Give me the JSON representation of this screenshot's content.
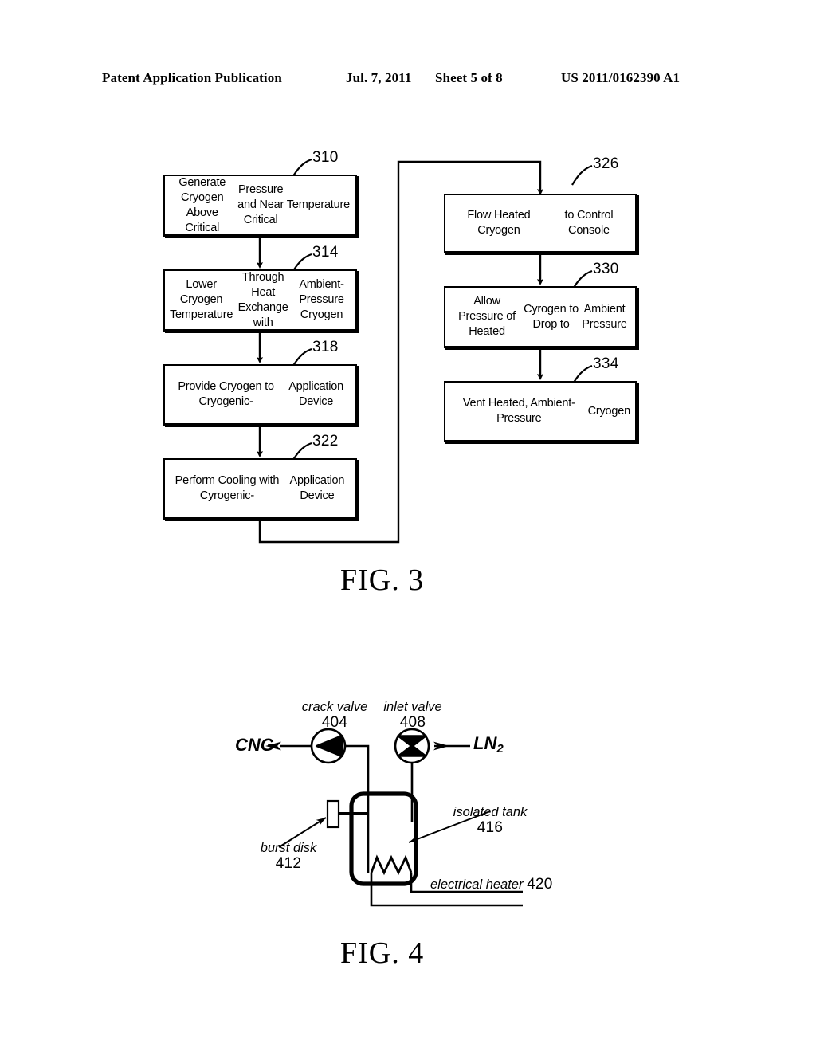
{
  "header": {
    "publication": "Patent Application Publication",
    "date": "Jul. 7, 2011",
    "sheet": "Sheet 5 of 8",
    "number": "US 2011/0162390 A1"
  },
  "figures": [
    {
      "caption": "FIG. 3",
      "type": "flowchart",
      "boxes": [
        {
          "ref": "310",
          "lines": [
            "Generate Cryogen Above Critical",
            "Pressure and Near Critical",
            "Temperature"
          ]
        },
        {
          "ref": "314",
          "lines": [
            "Lower Cryogen Temperature",
            "Through Heat Exchange with",
            "Ambient-Pressure Cryogen"
          ]
        },
        {
          "ref": "318",
          "lines": [
            "Provide Cryogen to Cryogenic-",
            "Application Device"
          ]
        },
        {
          "ref": "322",
          "lines": [
            "Perform Cooling with Cyrogenic-",
            "Application Device"
          ]
        },
        {
          "ref": "326",
          "lines": [
            "Flow Heated Cryogen",
            "to Control Console"
          ]
        },
        {
          "ref": "330",
          "lines": [
            "Allow Pressure of Heated",
            "Cyrogen to Drop to",
            "Ambient Pressure"
          ]
        },
        {
          "ref": "334",
          "lines": [
            "Vent Heated, Ambient-Pressure",
            "Cryogen"
          ]
        }
      ]
    },
    {
      "caption": "FIG. 4",
      "type": "schematic",
      "parts": [
        {
          "ref": "404",
          "label": "crack valve",
          "symbol": "check-valve-icon"
        },
        {
          "ref": "408",
          "label": "inlet valve",
          "symbol": "gate-valve-icon"
        },
        {
          "ref": "412",
          "label": "burst disk",
          "symbol": "burst-disk-icon"
        },
        {
          "ref": "416",
          "label": "isolated tank",
          "symbol": "tank-icon"
        },
        {
          "ref": "420",
          "label": "electrical heater",
          "symbol": "resistor-icon"
        }
      ],
      "streams": [
        {
          "name": "CNG",
          "sub": ""
        },
        {
          "name": "LN",
          "sub": "2"
        }
      ]
    }
  ],
  "colors": {
    "ink": "#000000",
    "paper": "#ffffff"
  }
}
